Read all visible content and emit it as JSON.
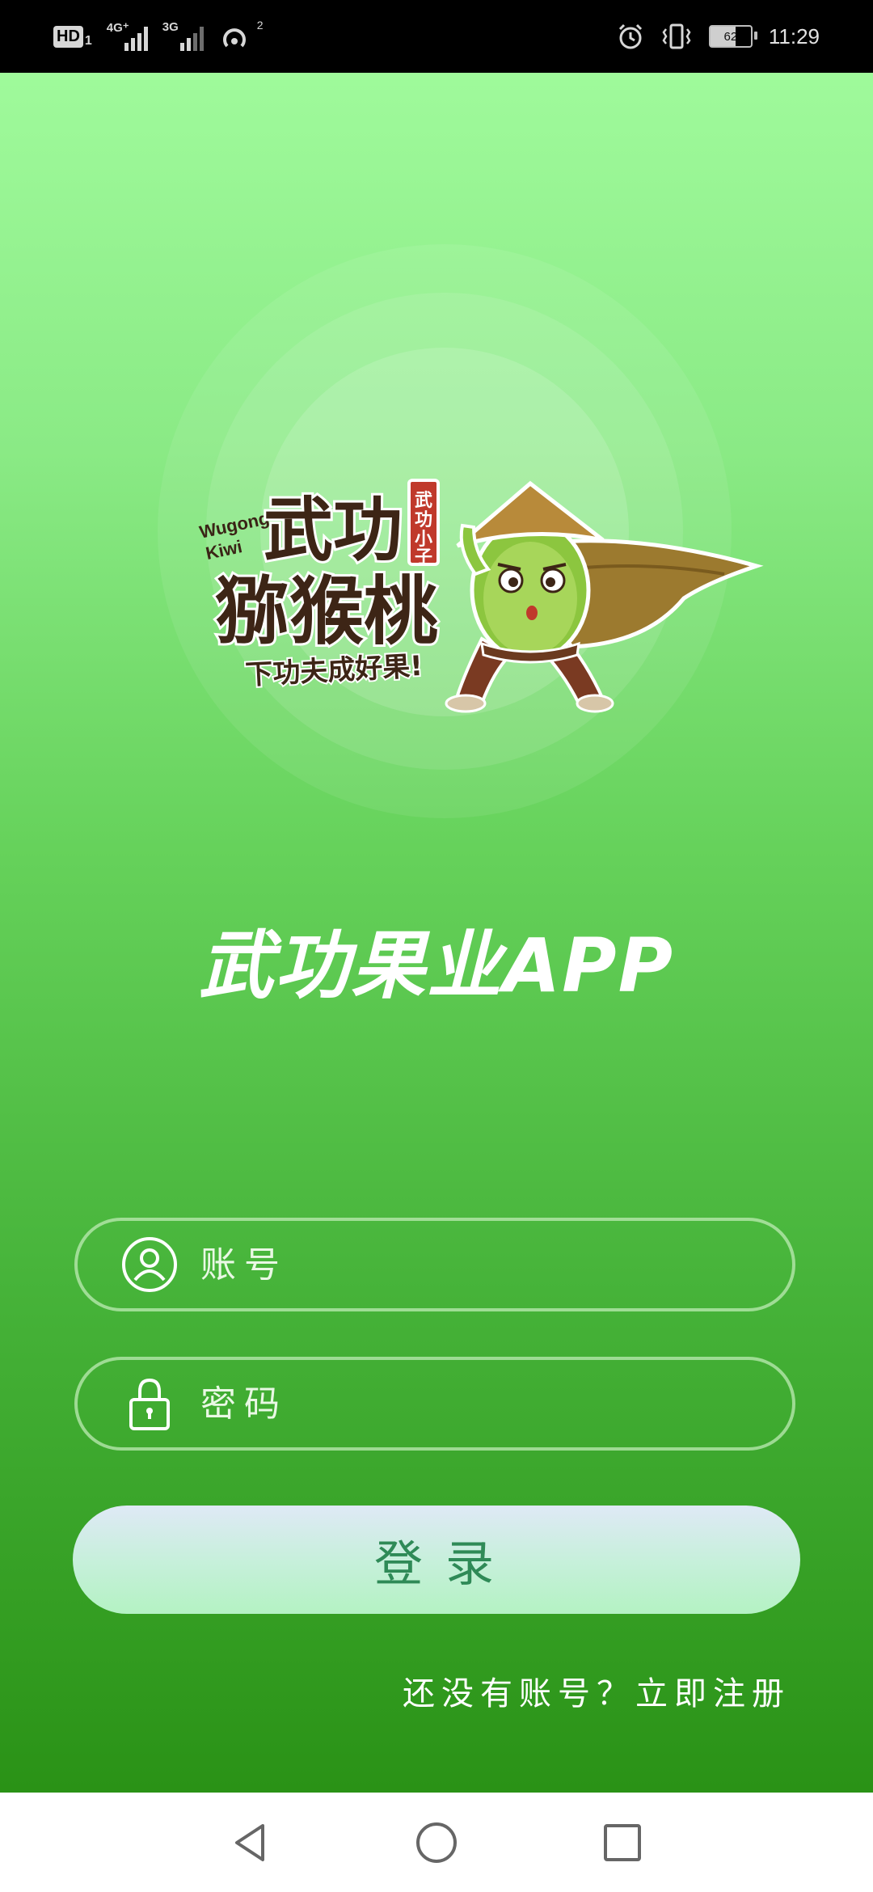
{
  "status_bar": {
    "hd_label": "HD",
    "hd_sub": "1",
    "network_1": "4G⁺",
    "network_2": "3G",
    "hotspot_count": "2",
    "battery": "62",
    "battery_level_percent": 62,
    "time": "11:29",
    "icons": [
      "signal-icon",
      "hotspot-icon",
      "alarm-icon",
      "vibrate-icon",
      "battery-icon"
    ]
  },
  "logo": {
    "text_en": "Wugong Kiwi",
    "text_main_1": "武功",
    "text_main_2": "猕猴桃",
    "seal": "武功小子",
    "slogan": "下功夫成好果!"
  },
  "app_title": "武功果业APP",
  "login_form": {
    "account_placeholder": "账号",
    "password_placeholder": "密码",
    "login_label": "登录",
    "register_link": "还没有账号？立即注册"
  },
  "colors": {
    "bg_top": "#9ffa9b",
    "bg_bottom": "#2a9216",
    "login_text": "#2f8a57"
  },
  "nav_bar": {
    "icons": [
      "back-icon",
      "home-icon",
      "recent-apps-icon"
    ]
  }
}
